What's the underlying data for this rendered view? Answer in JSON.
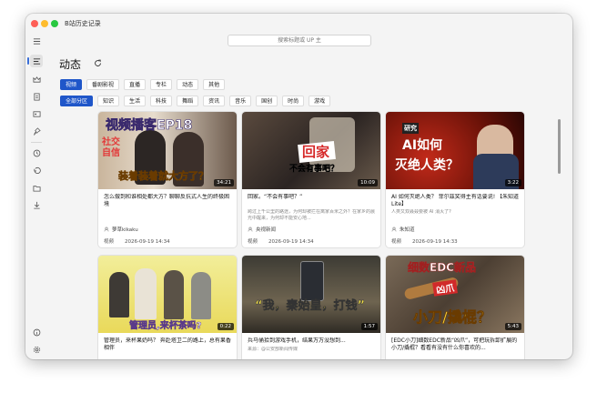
{
  "window": {
    "title": "B站历史记录"
  },
  "search": {
    "placeholder": "搜索标题或 UP 主"
  },
  "page": {
    "title": "动态"
  },
  "sidebar": {
    "icons": [
      "menu-icon",
      "history-icon",
      "live-icon",
      "article-icon",
      "card-icon",
      "pin-icon",
      "clock-icon",
      "undo-icon",
      "folder-icon",
      "download-icon",
      "info-icon",
      "settings-icon"
    ]
  },
  "type_tabs": [
    {
      "label": "视频",
      "active": true
    },
    {
      "label": "番剧影视",
      "active": false
    },
    {
      "label": "直播",
      "active": false
    },
    {
      "label": "专栏",
      "active": false
    },
    {
      "label": "动态",
      "active": false
    },
    {
      "label": "其他",
      "active": false
    }
  ],
  "category_tabs": [
    {
      "label": "全部分区",
      "active": true
    },
    {
      "label": "知识",
      "active": false
    },
    {
      "label": "生活",
      "active": false
    },
    {
      "label": "科技",
      "active": false
    },
    {
      "label": "舞蹈",
      "active": false
    },
    {
      "label": "资讯",
      "active": false
    },
    {
      "label": "音乐",
      "active": false
    },
    {
      "label": "国创",
      "active": false
    },
    {
      "label": "时尚",
      "active": false
    },
    {
      "label": "游戏",
      "active": false
    }
  ],
  "cards": [
    {
      "title": "怎么做到和谁相处都大方？聊聊反抗式人生的终极困境",
      "desc": "",
      "author": "萝草kikaku",
      "type": "视频",
      "time": "2026-09-19 14:34",
      "duration": "34:21",
      "overlay": [
        "视频播客EP18",
        "社交自信",
        "装着装着就大方了？"
      ]
    },
    {
      "title": "回家。“不会有事吧？”",
      "desc": "跨过上千公里的路途，为何却被拦在离家百米之外？在家乡的晨光中醒来，为何却不能安心地...",
      "author": "央视新闻",
      "type": "视频",
      "time": "2026-09-19 14:34",
      "duration": "10:09",
      "overlay": [
        "回家",
        "不会有事吧？"
      ]
    },
    {
      "title": "AI 如何灭绝人类？ 菲尔兹奖得主有话要说! 【朱知道Lite】",
      "desc": "人类又双叒叕要被 AI 消灭了?",
      "author": "朱知道",
      "type": "视频",
      "time": "2026-09-19 14:33",
      "duration": "3:22",
      "overlay": [
        "研究",
        "AI如何",
        "灭绝人类？"
      ]
    },
    {
      "title": "管理员，来杯果奶吗？ 奔赴塔卫二的路上，总有果香相伴",
      "desc": "",
      "author": "",
      "type": "",
      "time": "",
      "duration": "0:22",
      "overlay": [
        "管理员,来杯茶吗?"
      ]
    },
    {
      "title": "兵马俑拾到游戏手机，结果万万没想到...",
      "desc": "来源：@公安部新闻传媒",
      "author": "",
      "type": "",
      "time": "",
      "duration": "1:57",
      "overlay": [
        "“我，秦始皇，打钱”"
      ]
    },
    {
      "title": "[EDC小刀]细数EDC新品“凶爪”，可把玩拆卸扩展的小刀/撬棍？看看有没有什么你喜欢的...",
      "desc": "",
      "author": "",
      "type": "",
      "time": "",
      "duration": "5:43",
      "overlay": [
        "细数EDC新品",
        "凶爪",
        "小刀/撬棍？"
      ]
    }
  ]
}
